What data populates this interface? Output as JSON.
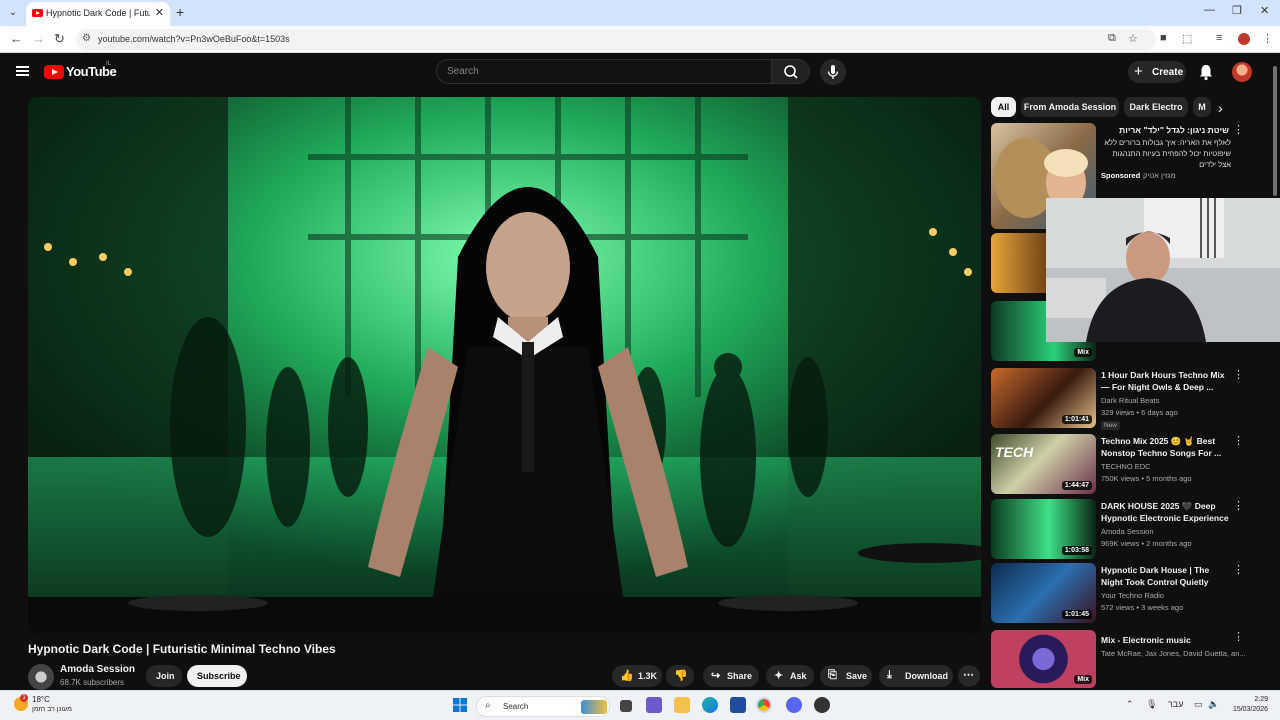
{
  "browser": {
    "tab_title": "Hypnotic Dark Code | Futuristic",
    "url": "youtube.com/watch?v=Pn3wOeBuFoo&t=1503s"
  },
  "header": {
    "logo_text": "YouTube",
    "country_code": "IL",
    "search_placeholder": "Search",
    "create_label": "Create"
  },
  "video": {
    "title": "Hypnotic Dark Code | Futuristic Minimal Techno Vibes",
    "channel": "Amoda Session",
    "subscribers": "68.7K subscribers",
    "join_label": "Join",
    "subscribe_label": "Subscribe",
    "likes": "1.3K",
    "share_label": "Share",
    "ask_label": "Ask",
    "save_label": "Save",
    "download_label": "Download"
  },
  "chips": [
    "All",
    "From Amoda Session",
    "Dark Electro",
    "M"
  ],
  "sponsored": {
    "title": "שיטת ניגון: לגדל \"ילד\" אריות",
    "desc": "לאלף את האריה: איך גבולות ברורים ללא שיפוטיות יכול להפחית בעיות התנהגות אצל ילדים",
    "badge": "Sponsored",
    "advertiser": "מגזין אטיק"
  },
  "mix_label": "Mix",
  "recommendations": [
    {
      "title": "1 Hour Dark Hours Techno Mix — For Night Owls & Deep ...",
      "channel": "Dark Ritual Beats",
      "meta": "329 views • 6 days ago",
      "badge": "New",
      "duration": "1:01:41"
    },
    {
      "title": "Techno Mix 2025 😊 🤘 Best Nonstop Techno Songs For ...",
      "channel": "TECHNO EDC",
      "meta": "750K views • 5 months ago",
      "badge": "",
      "duration": "1:44:47"
    },
    {
      "title": "DARK HOUSE 2025 🖤 Deep Hypnotic Electronic Experience",
      "channel": "Amoda Session",
      "meta": "969K views • 2 months ago",
      "badge": "",
      "duration": "1:03:58"
    },
    {
      "title": "Hypnotic Dark House | The Night Took Control Quietly",
      "channel": "Your Techno Radio",
      "meta": "572 views • 3 weeks ago",
      "badge": "",
      "duration": "1:01:45"
    },
    {
      "title": "Mix - Electronic music",
      "channel": "Tate McRae, Jax Jones, David Guetta, an...",
      "meta": "",
      "badge": "",
      "duration": "Mix"
    }
  ],
  "taskbar": {
    "temp": "18°C",
    "weather_desc": "מעונן רב הזמן",
    "weather_badge": "1",
    "search_label": "Search",
    "lang": "עבר",
    "time": "2:29",
    "date": "15/03/2026"
  }
}
